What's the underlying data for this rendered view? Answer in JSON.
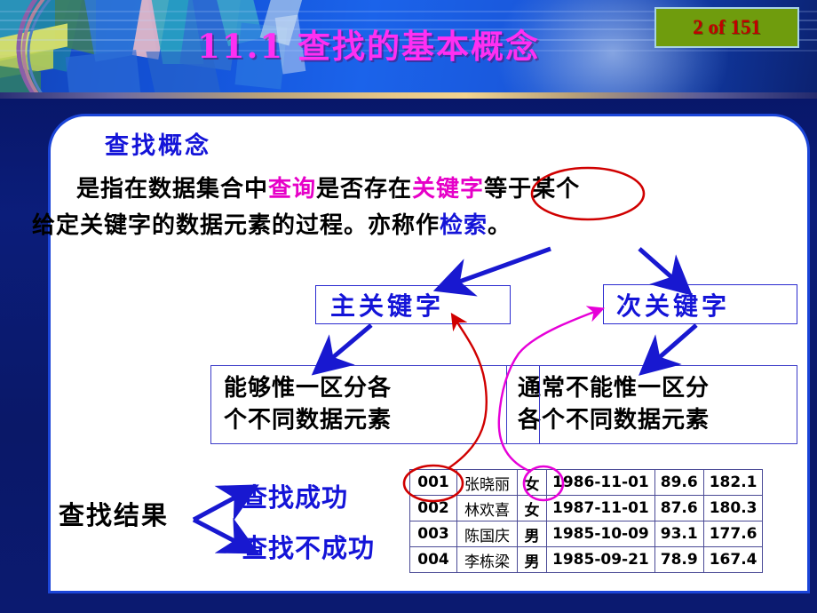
{
  "header": {
    "title": "11.1  查找的基本概念",
    "badge": "2 of 151",
    "badge_bg": "#6f9c0d",
    "badge_text_color": "#c20000",
    "title_color": "#ff2ff2"
  },
  "content": {
    "section_heading": "查找概念",
    "paragraph": {
      "line1_a": "是指在数据集合中",
      "line1_highlight1": "查询",
      "line1_b": "是否存在",
      "line1_highlight2": "关键字",
      "line1_c": "等于某个",
      "line2_a": "给定关键字的数据元素的过程。亦称作",
      "line2_highlight": "检索",
      "line2_b": "。"
    },
    "boxes": {
      "primary_key": "主关键字",
      "secondary_key": "次关键字",
      "primary_desc": [
        "能够惟一区分各",
        "个不同数据元素"
      ],
      "secondary_desc": [
        "通常不能惟一区分",
        "各个不同数据元素"
      ]
    },
    "result": {
      "label": "查找结果",
      "option_success": "查找成功",
      "option_fail": "查找不成功"
    }
  },
  "table": {
    "rows": [
      {
        "id": "001",
        "name": "张晓丽",
        "sex": "女",
        "birth": "1986-11-01",
        "score": "89.6",
        "height": "182.1"
      },
      {
        "id": "002",
        "name": "林欢喜",
        "sex": "女",
        "birth": "1987-11-01",
        "score": "87.6",
        "height": "180.3"
      },
      {
        "id": "003",
        "name": "陈国庆",
        "sex": "男",
        "birth": "1985-10-09",
        "score": "93.1",
        "height": "177.6"
      },
      {
        "id": "004",
        "name": "李栋梁",
        "sex": "男",
        "birth": "1985-09-21",
        "score": "78.9",
        "height": "167.4"
      }
    ]
  },
  "annotations": {
    "red_ellipse_keyword": "关键字",
    "red_ellipse_id": "001",
    "magenta_ellipse_sex": "女",
    "arrow_colors": {
      "blue": "#1818d0",
      "red": "#d00000",
      "magenta": "#e600d8"
    }
  }
}
